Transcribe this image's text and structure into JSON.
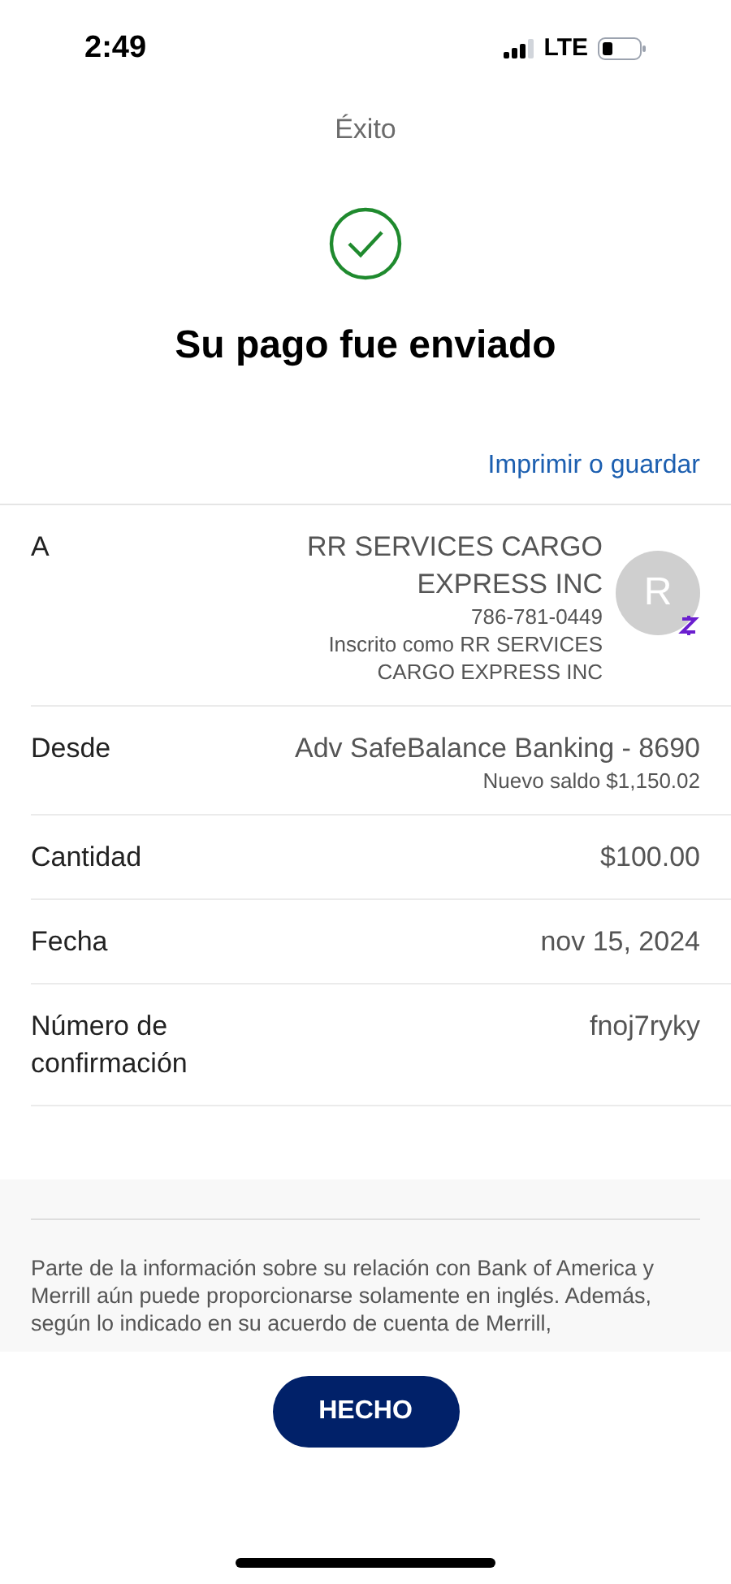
{
  "status_bar": {
    "time": "2:49",
    "network": "LTE"
  },
  "header": {
    "title": "Éxito"
  },
  "heading": "Su pago fue enviado",
  "print_link": "Imprimir o guardar",
  "rows": [
    {
      "label": "A",
      "value": "RR SERVICES CARGO EXPRESS INC",
      "details": [
        "786-781-0449",
        "Inscrito como RR SERVICES CARGO EXPRESS INC"
      ],
      "avatar": {
        "initial": "R"
      }
    },
    {
      "label": "Desde",
      "value": "Adv SafeBalance Banking - 8690",
      "details": [
        "Nuevo saldo $1,150.02"
      ]
    },
    {
      "label": "Cantidad",
      "value": "$100.00"
    },
    {
      "label": "Fecha",
      "value": "nov 15, 2024"
    },
    {
      "label": "Número de confirmación",
      "value": "fnoj7ryky"
    }
  ],
  "disclaimer": "Parte de la información sobre su relación con Bank of America y Merrill aún puede proporcionarse solamente en inglés. Además, según lo indicado en su acuerdo de cuenta de Merrill,",
  "done_button": "HECHO"
}
